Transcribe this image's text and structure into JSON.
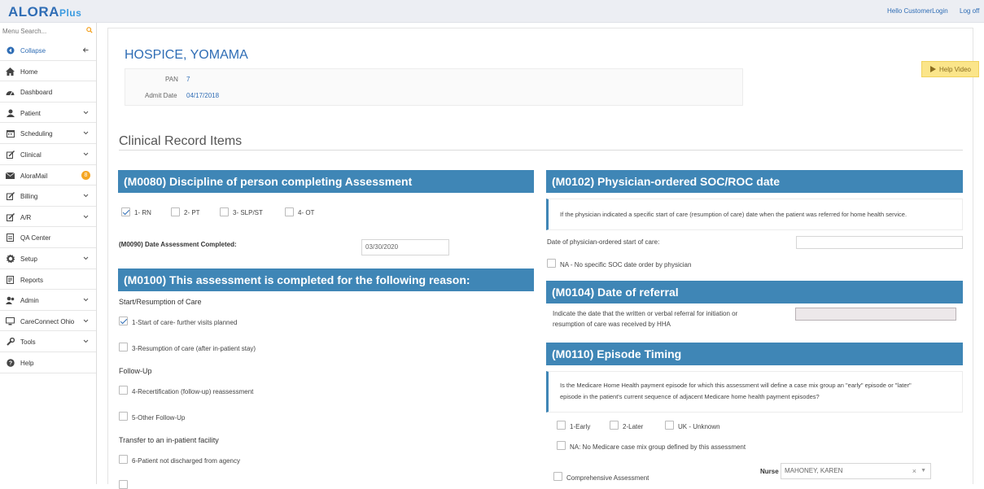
{
  "app": {
    "logo_main": "ALORA",
    "logo_plus": "Plus",
    "greeting": "Hello CustomerLogin",
    "logoff": "Log off"
  },
  "sidebar": {
    "search_placeholder": "Menu Search...",
    "items": [
      {
        "label": "Collapse",
        "icon": "collapse-icon"
      },
      {
        "label": "Home",
        "icon": "home-icon"
      },
      {
        "label": "Dashboard",
        "icon": "dashboard-icon"
      },
      {
        "label": "Patient",
        "icon": "patient-icon"
      },
      {
        "label": "Scheduling",
        "icon": "calendar-icon"
      },
      {
        "label": "Clinical",
        "icon": "edit-icon"
      },
      {
        "label": "AloraMail",
        "icon": "mail-icon",
        "badge": "8"
      },
      {
        "label": "Billing",
        "icon": "billing-icon"
      },
      {
        "label": "A/R",
        "icon": "ar-icon"
      },
      {
        "label": "QA Center",
        "icon": "qa-icon"
      },
      {
        "label": "Setup",
        "icon": "gear-icon"
      },
      {
        "label": "Reports",
        "icon": "reports-icon"
      },
      {
        "label": "Admin",
        "icon": "admin-icon"
      },
      {
        "label": "CareConnect Ohio",
        "icon": "monitor-icon"
      },
      {
        "label": "Tools",
        "icon": "wrench-icon"
      },
      {
        "label": "Help",
        "icon": "help-icon"
      }
    ]
  },
  "patient": {
    "name": "HOSPICE, YOMAMA",
    "pan_label": "PAN",
    "pan": "7",
    "admit_label": "Admit Date",
    "admit": "04/17/2018"
  },
  "help_video": "Help Video",
  "section_title": "Clinical Record Items",
  "m0080": {
    "title": "(M0080) Discipline of person completing Assessment",
    "options": [
      "1- RN",
      "2- PT",
      "3- SLP/ST",
      "4- OT"
    ],
    "checked": [
      true,
      false,
      false,
      false
    ]
  },
  "m0090": {
    "label": "(M0090) Date Assessment Completed:",
    "value": "03/30/2020"
  },
  "m0100": {
    "title": "(M0100) This assessment is completed for the following reason:",
    "groups": [
      "Start/Resumption of Care",
      "Follow-Up",
      "Transfer to an in-patient facility"
    ],
    "options": [
      "1-Start of care- further visits planned",
      "3-Resumption of care (after in-patient stay)",
      "4-Recertification (follow-up) reassessment",
      "5-Other Follow-Up",
      "6-Patient not discharged from agency"
    ],
    "checked": [
      true,
      false,
      false,
      false,
      false
    ]
  },
  "m0102": {
    "title": "(M0102) Physician-ordered SOC/ROC date",
    "note": "If the physician indicated a specific start of care (resumption of care) date when the patient was referred for home health service.",
    "date_label": "Date of physician-ordered start of care:",
    "date_value": "",
    "na": "NA - No specific SOC date order by physician"
  },
  "m0104": {
    "title": "(M0104) Date of referral",
    "line1": "Indicate the date that the written or verbal referral for initiation or",
    "line2": "resumption of care was received by HHA",
    "value": ""
  },
  "m0110": {
    "title": "(M0110) Episode Timing",
    "line1": "Is the Medicare Home Health payment episode for which this assessment will define a case mix group an \"early\" episode or \"later\"",
    "line2": "episode in the patient's current sequence of adjacent Medicare home health payment episodes?",
    "options": [
      "1-Early",
      "2-Later",
      "UK - Unknown"
    ],
    "na": "NA: No Medicare case mix group defined by this assessment"
  },
  "footer": {
    "comprehensive": "Comprehensive Assessment",
    "nurse_label": "Nurse",
    "nurse_value": "MAHONEY, KAREN"
  },
  "colors": {
    "accent": "#3f86b6",
    "link": "#2f6db5",
    "badge": "#f5a623",
    "help": "#fbe58a"
  }
}
